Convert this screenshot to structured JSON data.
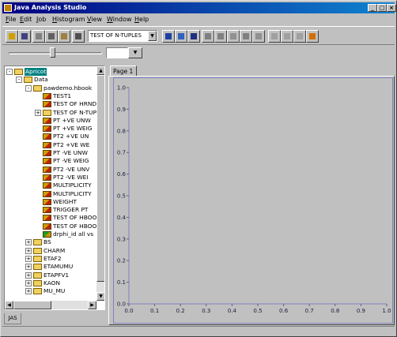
{
  "window": {
    "title": "Java Analysis Studio",
    "caption_buttons": [
      "_",
      "□",
      "×"
    ]
  },
  "menubar": {
    "items": [
      {
        "label": "File",
        "accel": "F"
      },
      {
        "label": "Edit",
        "accel": "E"
      },
      {
        "label": "Job",
        "accel": "J"
      },
      {
        "label": "Histogram",
        "accel": "H"
      },
      {
        "label": "View",
        "accel": "V"
      },
      {
        "label": "Window",
        "accel": "W"
      },
      {
        "label": "Help",
        "accel": "H"
      }
    ]
  },
  "toolbar": {
    "group1_icons": [
      "open-icon",
      "save-icon",
      "cut-icon",
      "copy-icon",
      "paste-icon"
    ],
    "print_icon": "print-icon",
    "combo_value": "TEST OF N-TUPLES",
    "group2_icons": [
      "histogram-view-icon",
      "zoom-icon",
      "fit-icon"
    ],
    "group3_icons": [
      "job-step-icon",
      "job-rewind-icon",
      "job-go-icon",
      "job-stop-icon",
      "job-refresh-icon",
      "back-icon",
      "forward-icon",
      "page-icon",
      "home-icon"
    ],
    "accent": "#000080"
  },
  "slider": {
    "value": 0.47,
    "field_value": ""
  },
  "tree": {
    "items": [
      {
        "level": 0,
        "toggle": "-",
        "icon": "folder-icon",
        "label": "Apricot",
        "selected": true
      },
      {
        "level": 1,
        "toggle": "-",
        "icon": "folder-icon",
        "label": "Data"
      },
      {
        "level": 2,
        "toggle": "-",
        "icon": "folder-icon",
        "label": "pawdemo.hbook"
      },
      {
        "level": 3,
        "toggle": "",
        "icon": "histogram-1d-icon",
        "label": "TEST1"
      },
      {
        "level": 3,
        "toggle": "",
        "icon": "histogram-1d-icon",
        "label": "TEST OF HRND"
      },
      {
        "level": 3,
        "toggle": "+",
        "icon": "folder-icon",
        "label": "TEST OF N-TUP"
      },
      {
        "level": 3,
        "toggle": "",
        "icon": "histogram-1d-icon",
        "label": "PT  +VE  UNW"
      },
      {
        "level": 3,
        "toggle": "",
        "icon": "histogram-1d-icon",
        "label": "PT  +VE  WEIG"
      },
      {
        "level": 3,
        "toggle": "",
        "icon": "histogram-1d-icon",
        "label": "PT2  +VE  UN"
      },
      {
        "level": 3,
        "toggle": "",
        "icon": "histogram-1d-icon",
        "label": "PT2  +VE  WE"
      },
      {
        "level": 3,
        "toggle": "",
        "icon": "histogram-1d-icon",
        "label": "PT  -VE  UNW"
      },
      {
        "level": 3,
        "toggle": "",
        "icon": "histogram-1d-icon",
        "label": "PT  -VE  WEIG"
      },
      {
        "level": 3,
        "toggle": "",
        "icon": "histogram-1d-icon",
        "label": "PT2  -VE  UNV"
      },
      {
        "level": 3,
        "toggle": "",
        "icon": "histogram-1d-icon",
        "label": "PT2  -VE  WEI"
      },
      {
        "level": 3,
        "toggle": "",
        "icon": "histogram-1d-icon",
        "label": "MULTIPLICITY"
      },
      {
        "level": 3,
        "toggle": "",
        "icon": "histogram-1d-icon",
        "label": "MULTIPLICITY"
      },
      {
        "level": 3,
        "toggle": "",
        "icon": "histogram-1d-icon",
        "label": "WEIGHT"
      },
      {
        "level": 3,
        "toggle": "",
        "icon": "histogram-1d-icon",
        "label": "TRIGGER PT"
      },
      {
        "level": 3,
        "toggle": "",
        "icon": "histogram-1d-icon",
        "label": "TEST OF HBOO"
      },
      {
        "level": 3,
        "toggle": "",
        "icon": "histogram-1d-icon",
        "label": "TEST OF HBOO"
      },
      {
        "level": 3,
        "toggle": "",
        "icon": "ntuple-icon",
        "label": "drphi_id all vs"
      },
      {
        "level": 2,
        "toggle": "+",
        "icon": "folder-icon",
        "label": "BS"
      },
      {
        "level": 2,
        "toggle": "+",
        "icon": "folder-icon",
        "label": "CHARM"
      },
      {
        "level": 2,
        "toggle": "+",
        "icon": "folder-icon",
        "label": "ETAF2"
      },
      {
        "level": 2,
        "toggle": "+",
        "icon": "folder-icon",
        "label": "ETAMUMU"
      },
      {
        "level": 2,
        "toggle": "+",
        "icon": "folder-icon",
        "label": "ETAPFV1"
      },
      {
        "level": 2,
        "toggle": "+",
        "icon": "folder-icon",
        "label": "KAON"
      },
      {
        "level": 2,
        "toggle": "+",
        "icon": "folder-icon",
        "label": "MU_MU"
      }
    ]
  },
  "tabs": [
    {
      "label": "Page 1",
      "active": true
    }
  ],
  "statusbar": {
    "tab_label": "JAS"
  },
  "chart_data": {
    "type": "scatter",
    "xlim": [
      0.0,
      1.0
    ],
    "ylim": [
      0.0,
      1.0
    ],
    "x_ticks": [
      "0.0",
      "0.1",
      "0.2",
      "0.3",
      "0.4",
      "0.5",
      "0.6",
      "0.7",
      "0.8",
      "0.9",
      "1.0"
    ],
    "y_ticks": [
      "0.0",
      "0.1",
      "0.2",
      "0.3",
      "0.4",
      "0.5",
      "0.6",
      "0.7",
      "0.8",
      "0.9",
      "1.0"
    ],
    "series": [],
    "grid": false
  }
}
